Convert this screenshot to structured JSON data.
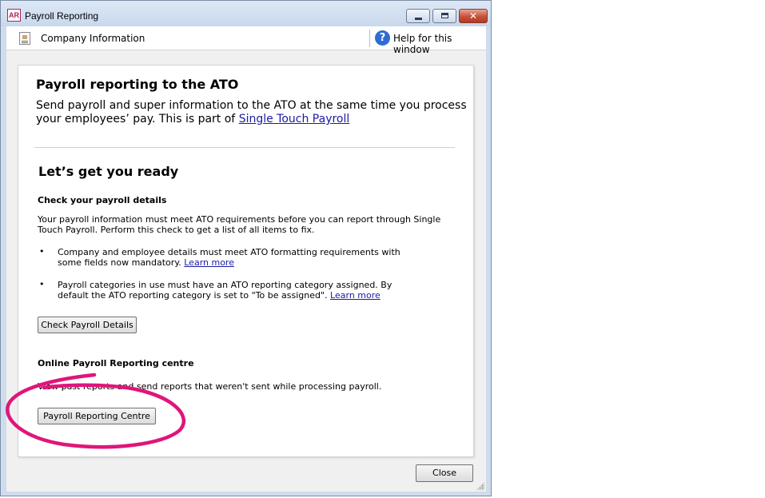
{
  "window": {
    "title": "Payroll Reporting",
    "app_badge": "AR",
    "controls": {
      "close_glyph": "✕"
    }
  },
  "toolbar": {
    "company_info_label": "Company Information",
    "help_label": "Help for this window",
    "help_glyph": "?"
  },
  "content": {
    "heading": "Payroll reporting to the ATO",
    "intro_text": "Send payroll and super information to the ATO at the same time you process your employees’ pay. This is part of ",
    "intro_link": "Single Touch Payroll",
    "ready_heading": "Let’s get you ready",
    "check_section": {
      "heading": "Check your payroll details",
      "paragraph": "Your payroll information must meet ATO requirements before you can report through Single Touch Payroll. Perform this check to get a list of all items to fix.",
      "bullets": [
        {
          "text": "Company and employee details must meet ATO formatting requirements with some fields now mandatory. ",
          "link": "Learn more"
        },
        {
          "text": "Payroll categories in use must have an ATO reporting category assigned. By default the ATO reporting category is set to \"To be assigned\". ",
          "link": "Learn more"
        }
      ],
      "button_label": "Check Payroll Details"
    },
    "online_section": {
      "heading": "Online Payroll Reporting centre",
      "paragraph": "View past reports and send reports that weren't sent while processing payroll.",
      "button_label": "Payroll Reporting Centre"
    },
    "bullet_char": "•"
  },
  "footer": {
    "close_label": "Close"
  },
  "colors": {
    "link": "#1a1aa6",
    "annotation": "#e0157a",
    "help_icon": "#2f6bd1"
  }
}
